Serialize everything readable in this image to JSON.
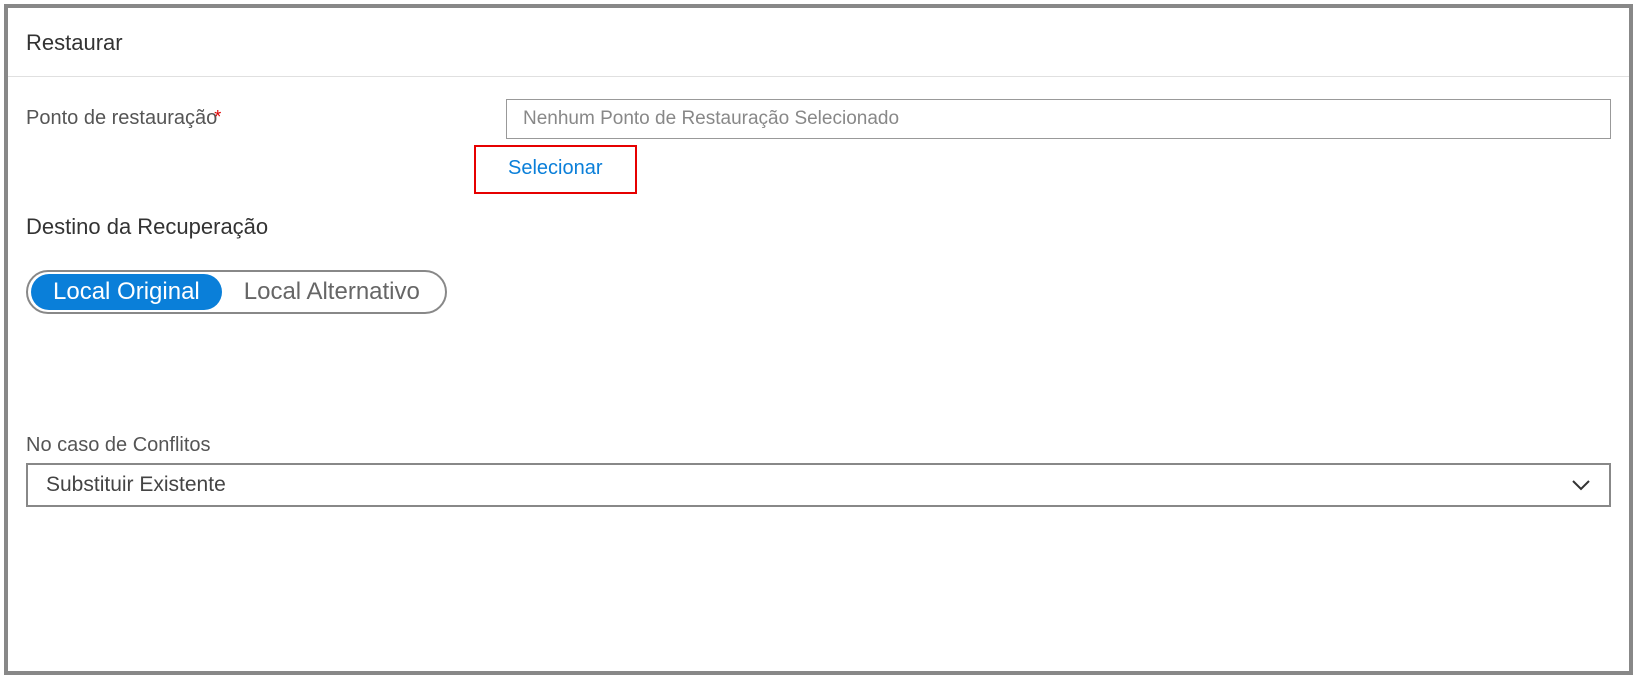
{
  "header": {
    "title": "Restaurar"
  },
  "restorePoint": {
    "label": "Ponto de restauração",
    "placeholder": "Nenhum Ponto de Restauração Selecionado",
    "selectLink": "Selecionar"
  },
  "destination": {
    "heading": "Destino da Recuperação",
    "options": {
      "original": "Local Original",
      "alternative": "Local Alternativo"
    }
  },
  "conflicts": {
    "label": "No caso de Conflitos",
    "selected": "Substituir Existente"
  }
}
